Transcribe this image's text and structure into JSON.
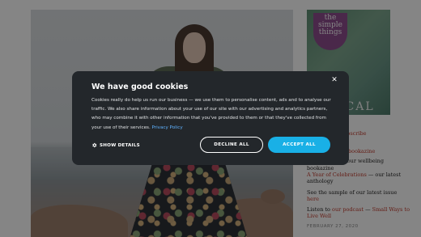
{
  "cookie_modal": {
    "title": "We have good cookies",
    "close_symbol": "✕",
    "body": "Cookies really do help us run our business — we use them to personalise content, ads and to analyse our traffic. We also share information about your use of our site with our advertising and analytics partners, who may combine it with other information that you've provided to them or that they've collected from your use of their services.",
    "privacy_link": "Privacy Policy",
    "show_details": "SHOW DETAILS",
    "decline_label": "DECLINE ALL",
    "accept_label": "ACCEPT ALL",
    "accent_color": "#19b0e6"
  },
  "background": {
    "magazine_title": "the simple things",
    "magazine_word": "ICAL",
    "sidebar": [
      {
        "link": "",
        "text": "ubscribe"
      },
      {
        "link": "bookazine",
        "text": ""
      },
      {
        "link": "",
        "text": "t, our wellbeing"
      },
      {
        "link": "",
        "text": "bookazine"
      },
      {
        "link": "A Year of Celebrations",
        "text": " — our latest anthology"
      },
      {
        "link": "",
        "text": "See the sample of our latest issue"
      },
      {
        "link": "here",
        "text": ""
      },
      {
        "link": "our podcast",
        "text": "Listen to ",
        "tail_link": "Small Ways to Live Well",
        "tail_pre": " — "
      }
    ],
    "date": "FEBRUARY 27, 2020"
  }
}
